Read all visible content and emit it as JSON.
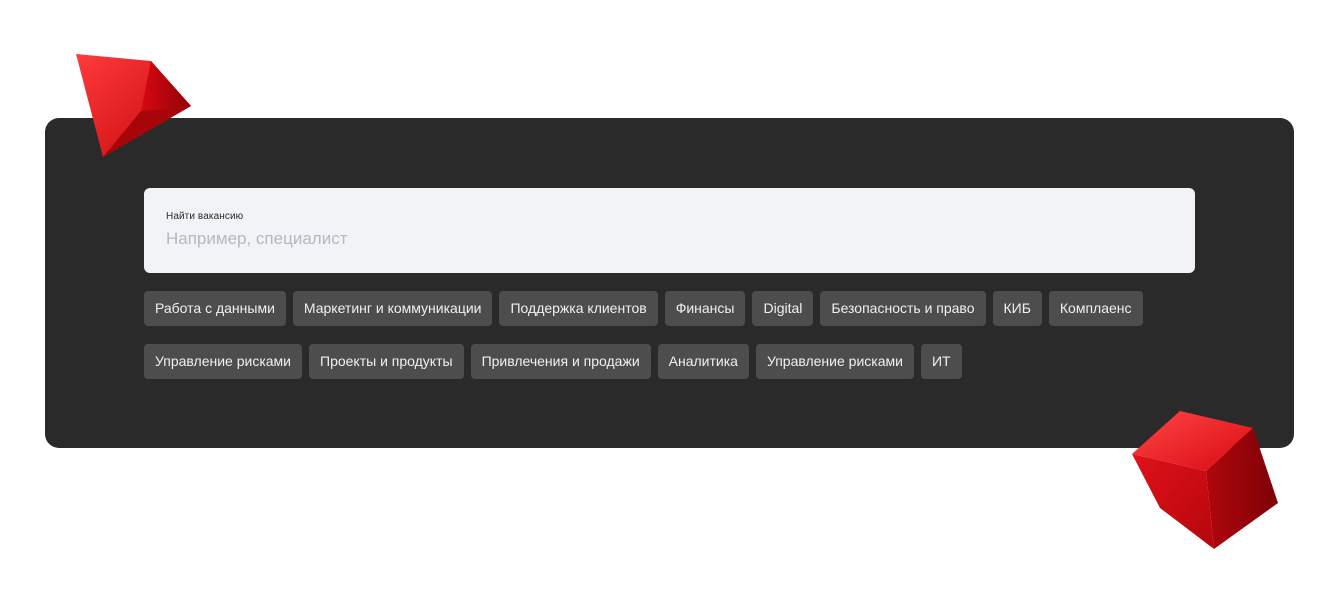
{
  "search": {
    "label": "Найти вакансию",
    "placeholder": "Например, специалист",
    "value": ""
  },
  "categories": {
    "row1": [
      "Работа с данными",
      "Маркетинг и коммуникации",
      "Поддержка клиентов",
      "Финансы",
      "Digital",
      "Безопасность и право",
      "КИБ",
      "Комплаенс"
    ],
    "row2": [
      "Управление рисками",
      "Проекты и продукты",
      "Привлечения и продажи",
      "Аналитика",
      "Управление рисками",
      "ИТ"
    ]
  },
  "colors": {
    "panel": "#2a2a2a",
    "tag_bg": "#4d4d4d",
    "search_bg": "#f2f3f7",
    "accent": "#e3141b"
  }
}
